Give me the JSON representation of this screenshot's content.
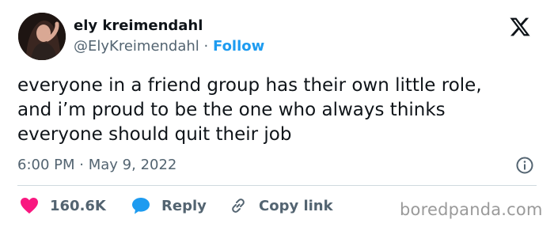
{
  "author": {
    "display_name": "ely kreimendahl",
    "handle": "@ElyKreimendahl",
    "separator": "·",
    "follow_label": "Follow"
  },
  "tweet": {
    "lines": [
      "everyone in a friend group has their own little role,",
      "and i’m proud to be the one who always thinks",
      "everyone should quit their job"
    ],
    "time": "6:00 PM",
    "date_separator": "·",
    "date": "May 9, 2022"
  },
  "actions": {
    "like_count": "160.6K",
    "reply_label": "Reply",
    "copy_label": "Copy link"
  },
  "watermark": "boredpanda.com",
  "icons": {
    "logo": "x-logo-icon",
    "info": "info-icon",
    "like": "heart-icon",
    "reply": "speech-bubble-icon",
    "copy": "link-icon"
  },
  "colors": {
    "text": "#0f1419",
    "secondary": "#536471",
    "accent": "#1d9bf0",
    "like": "#f91880",
    "divider": "#cfd9de",
    "watermark": "#9a9a9a"
  }
}
